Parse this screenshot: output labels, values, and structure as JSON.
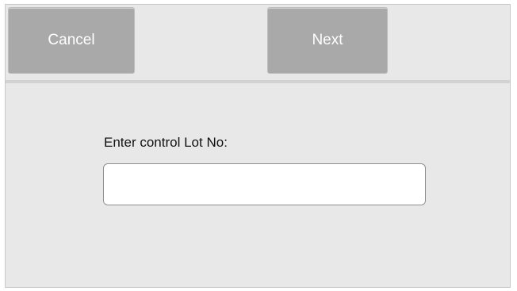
{
  "toolbar": {
    "cancel_label": "Cancel",
    "next_label": "Next"
  },
  "form": {
    "lot_label": "Enter control Lot No:",
    "lot_value": "",
    "lot_placeholder": ""
  },
  "colors": {
    "background": "#e8e8e8",
    "button": "#a9a9a9",
    "button_text": "#ffffff",
    "divider": "#d2d2d2"
  }
}
